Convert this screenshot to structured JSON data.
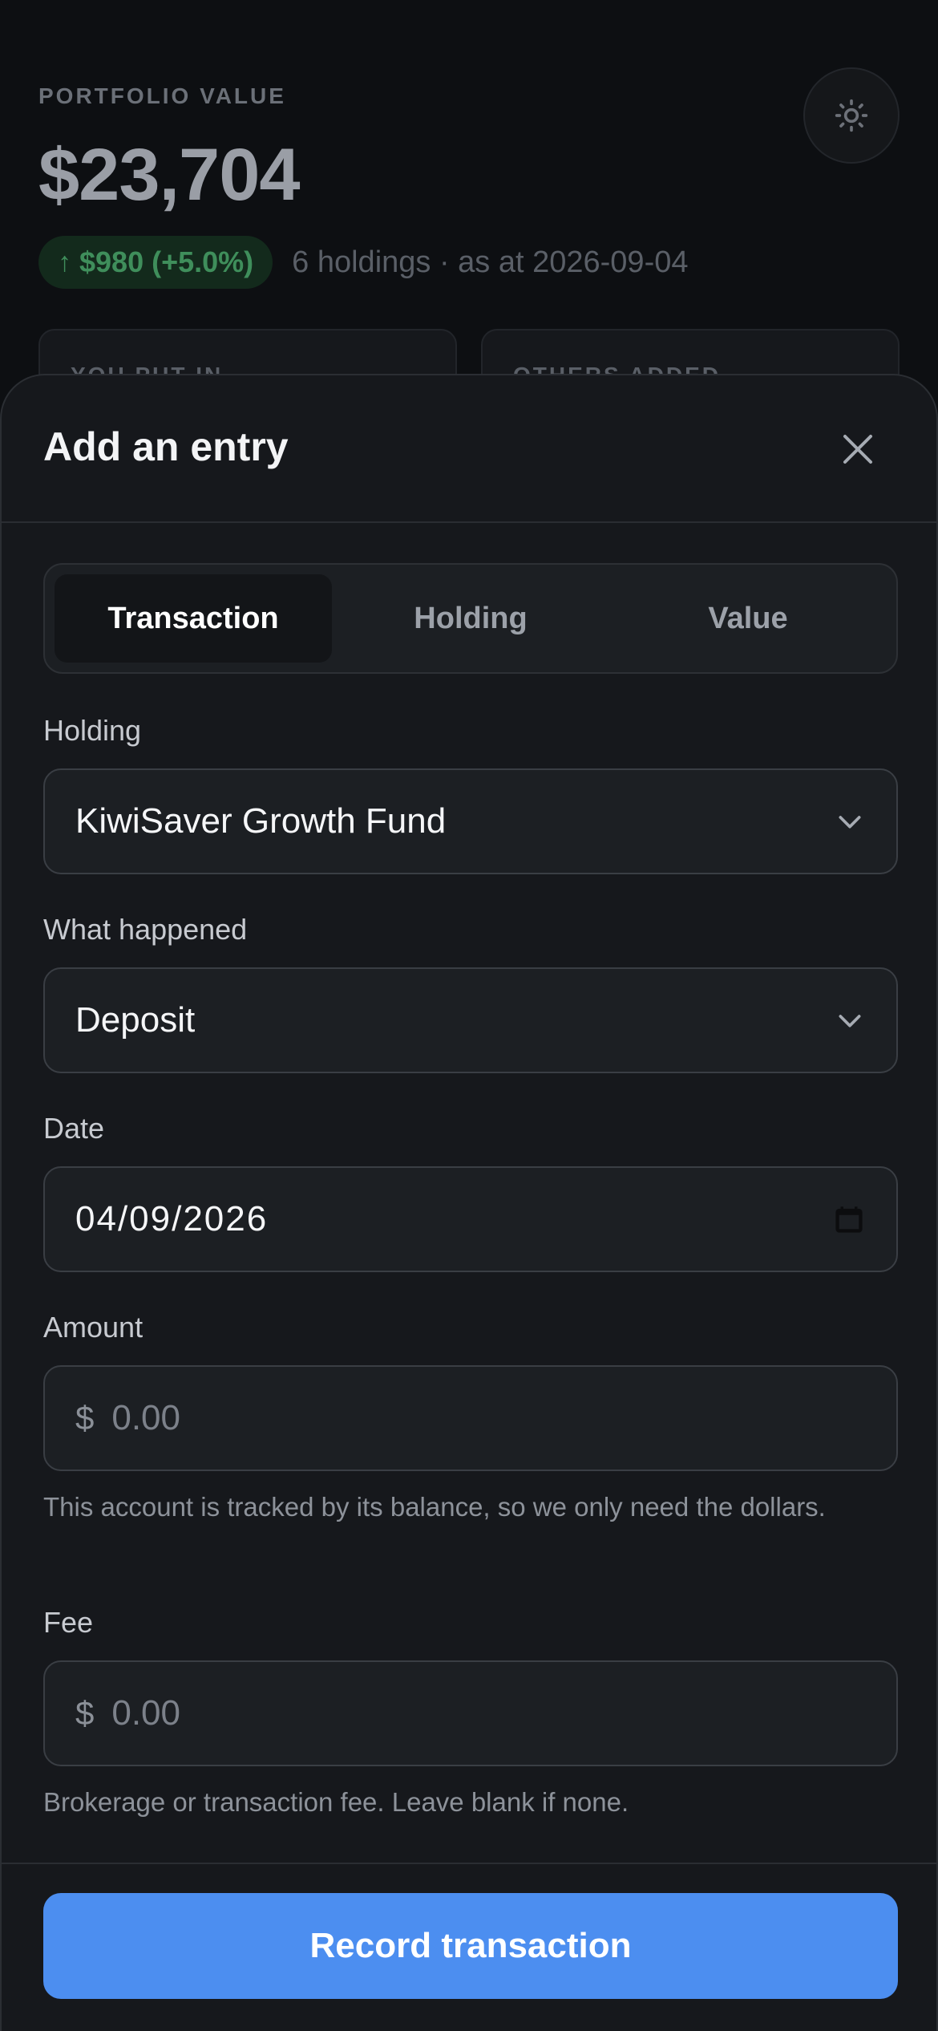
{
  "dashboard": {
    "portfolio_label": "PORTFOLIO VALUE",
    "portfolio_value": "$23,704",
    "change_badge": "$980 (+5.0%)",
    "meta": "6 holdings · as at 2026-09-04",
    "card_left_label": "YOU PUT IN",
    "card_right_label": "OTHERS ADDED",
    "change_color": "#3f8e5b"
  },
  "sheet": {
    "title": "Add an entry",
    "tabs": [
      {
        "label": "Transaction",
        "active": true
      },
      {
        "label": "Holding",
        "active": false
      },
      {
        "label": "Value",
        "active": false
      }
    ],
    "holding": {
      "label": "Holding",
      "value": "KiwiSaver Growth Fund"
    },
    "what_happened": {
      "label": "What happened",
      "value": "Deposit"
    },
    "date": {
      "label": "Date",
      "value": "04/09/2026"
    },
    "amount": {
      "label": "Amount",
      "prefix": "$",
      "placeholder": "0.00",
      "help": "This account is tracked by its balance, so we only need the dollars."
    },
    "fee": {
      "label": "Fee",
      "prefix": "$",
      "placeholder": "0.00",
      "help": "Brokerage or transaction fee. Leave blank if none."
    },
    "submit_label": "Record transaction",
    "accent_color": "#4c8ef0"
  },
  "icons": {
    "theme": "sun-icon",
    "close": "close-icon",
    "dropdown": "chevron-down-icon",
    "calendar": "calendar-icon",
    "change": "arrow-up-icon"
  }
}
